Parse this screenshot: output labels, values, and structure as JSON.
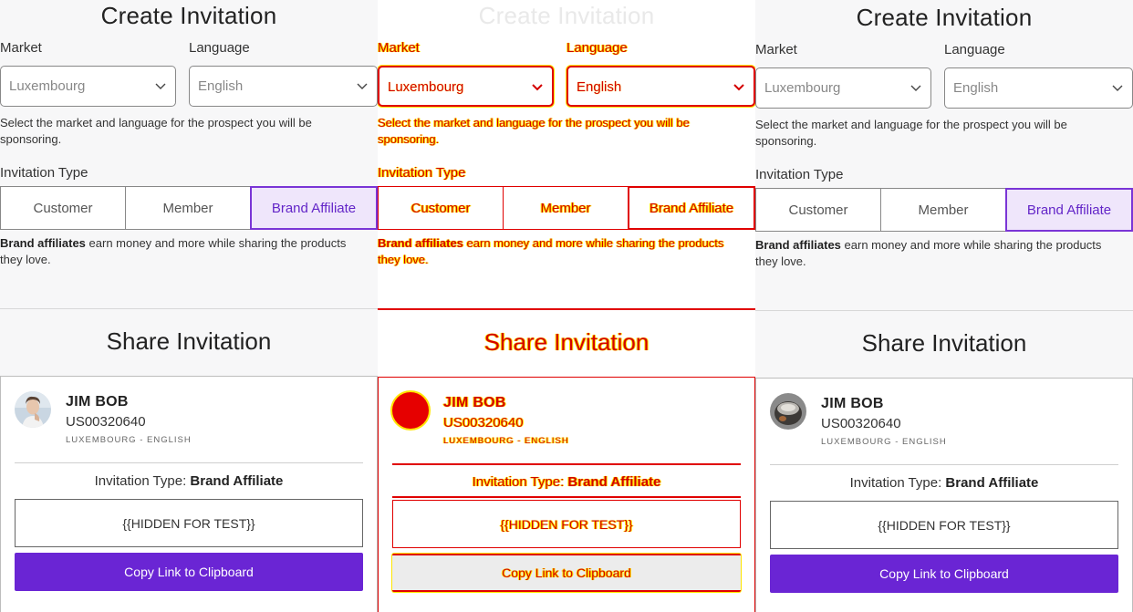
{
  "create": {
    "title": "Create Invitation",
    "market_label": "Market",
    "market_value": "Luxembourg",
    "language_label": "Language",
    "language_value": "English",
    "help_text": "Select the market and language for the prospect you will be sponsoring.",
    "type_label": "Invitation Type",
    "types": [
      "Customer",
      "Member",
      "Brand Affiliate"
    ],
    "selected_type": "Brand Affiliate",
    "desc_bold": "Brand affiliates",
    "desc_rest": " earn money and more while sharing the products they love."
  },
  "share": {
    "title": "Share Invitation",
    "user_name": "JIM BOB",
    "user_id": "US00320640",
    "user_location": "LUXEMBOURG - ENGLISH",
    "type_prefix": "Invitation Type: ",
    "type_value": "Brand Affiliate",
    "link_placeholder": "{{HIDDEN FOR TEST}}",
    "copy_button": "Copy Link to Clipboard"
  },
  "colors": {
    "accent": "#6a25d4",
    "active_segment_bg": "#efe6fb",
    "diff_red": "#e00000",
    "diff_yellow": "#ffe600"
  },
  "icons": {
    "select_chevron": "chevron-down-icon",
    "avatar_left": "avatar-photo-woman",
    "avatar_center": "avatar-diff-marker",
    "avatar_right": "avatar-photo-cookware"
  }
}
